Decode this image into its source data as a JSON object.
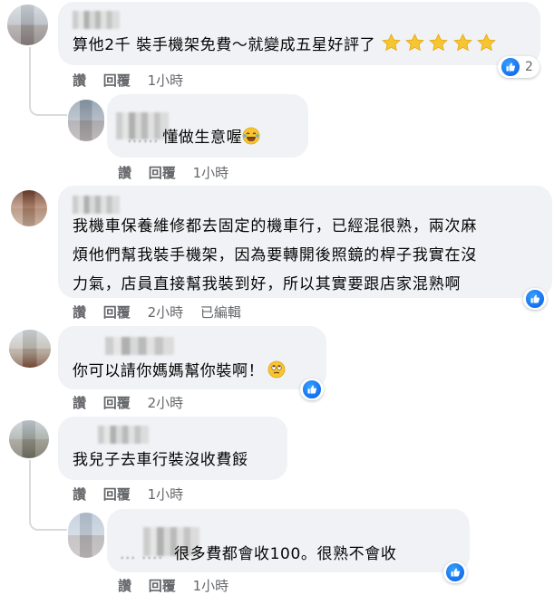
{
  "comments": [
    {
      "text_lines": [
        "算他2千 裝手機架免費～就變成五星好評了"
      ],
      "stars": 5,
      "actions": {
        "like": "讚",
        "reply": "回覆",
        "time": "1小時"
      },
      "reactions": {
        "icon": "like-icon",
        "count": "2"
      }
    },
    {
      "prefix": "……",
      "text_lines": [
        "懂做生意喔"
      ],
      "emoji": "laughing-emoji",
      "actions": {
        "like": "讚",
        "reply": "回覆",
        "time": "1小時"
      }
    },
    {
      "text_lines": [
        "我機車保養維修都去固定的機車行，已經混很熟，兩次麻",
        "煩他們幫我裝手機架，因為要轉開後照鏡的桿子我實在沒",
        "力氣，店員直接幫我裝到好，所以其實要跟店家混熟啊"
      ],
      "actions": {
        "like": "讚",
        "reply": "回覆",
        "time": "2小時",
        "edited": "已編輯"
      },
      "reactions": {
        "icon": "like-icon"
      }
    },
    {
      "text_lines": [
        "你可以請你媽媽幫你裝啊！"
      ],
      "emoji": "eye-roll-emoji",
      "actions": {
        "like": "讚",
        "reply": "回覆",
        "time": "2小時"
      },
      "reactions": {
        "icon": "like-icon"
      }
    },
    {
      "text_lines": [
        "我兒子去車行裝沒收費餒"
      ],
      "actions": {
        "like": "讚",
        "reply": "回覆",
        "time": "1小時"
      }
    },
    {
      "prefix": "... ....",
      "text_lines": [
        "很多費都會收100。很熟不會收"
      ],
      "actions": {
        "like": "讚",
        "reply": "回覆",
        "time": "1小時"
      },
      "reactions": {
        "icon": "like-icon"
      }
    }
  ],
  "colors": {
    "bubble": "#f0f2f5",
    "meta_text": "#65676b",
    "like_blue": "#1877f2",
    "thread_line": "#d8dadf"
  }
}
